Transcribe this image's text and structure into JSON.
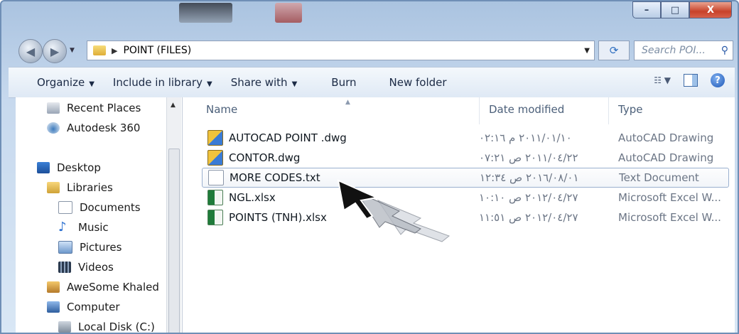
{
  "window": {
    "caption_minimize": "–",
    "caption_maximize": "□",
    "caption_close": "X"
  },
  "address": {
    "path": "POINT (FILES)",
    "separator": "▶",
    "search_placeholder": "Search POI..."
  },
  "toolbar": {
    "organize": "Organize",
    "include_in_library": "Include in library",
    "share_with": "Share with",
    "burn": "Burn",
    "new_folder": "New folder"
  },
  "sidebar": {
    "items": [
      {
        "label": "Recent Places",
        "icon": "recent-places-icon"
      },
      {
        "label": "Autodesk 360",
        "icon": "cloud-icon"
      },
      {
        "label": "Desktop",
        "icon": "desktop-icon"
      },
      {
        "label": "Libraries",
        "icon": "libraries-icon"
      },
      {
        "label": "Documents",
        "icon": "documents-icon"
      },
      {
        "label": "Music",
        "icon": "music-icon"
      },
      {
        "label": "Pictures",
        "icon": "pictures-icon"
      },
      {
        "label": "Videos",
        "icon": "videos-icon"
      },
      {
        "label": "AweSome Khaled",
        "icon": "user-folder-icon"
      },
      {
        "label": "Computer",
        "icon": "computer-icon"
      },
      {
        "label": "Local Disk (C:)",
        "icon": "disk-icon"
      }
    ]
  },
  "columns": {
    "name": "Name",
    "date": "Date modified",
    "type": "Type"
  },
  "files": [
    {
      "name": "AUTOCAD POINT .dwg",
      "date": "٢٠١١/٠١/١٠ م ٠٢:١٦",
      "type": "AutoCAD Drawing",
      "icon": "dwg"
    },
    {
      "name": "CONTOR.dwg",
      "date": "٢٠١١/٠٤/٢٢ ص ٠٧:٢١",
      "type": "AutoCAD Drawing",
      "icon": "dwg"
    },
    {
      "name": "MORE CODES.txt",
      "date": "٢٠١٦/٠٨/٠١ ص ١٢:٣٤",
      "type": "Text Document",
      "icon": "txt"
    },
    {
      "name": "NGL.xlsx",
      "date": "٢٠١٢/٠٤/٢٧ ص ١٠:١٠",
      "type": "Microsoft Excel W...",
      "icon": "xls"
    },
    {
      "name": "POINTS (TNH).xlsx",
      "date": "٢٠١٢/٠٤/٢٧ ص ١١:٥١",
      "type": "Microsoft Excel W...",
      "icon": "xls"
    }
  ],
  "colors": {
    "accent": "#2a5aa8",
    "selection_border": "#9ab0cf"
  }
}
